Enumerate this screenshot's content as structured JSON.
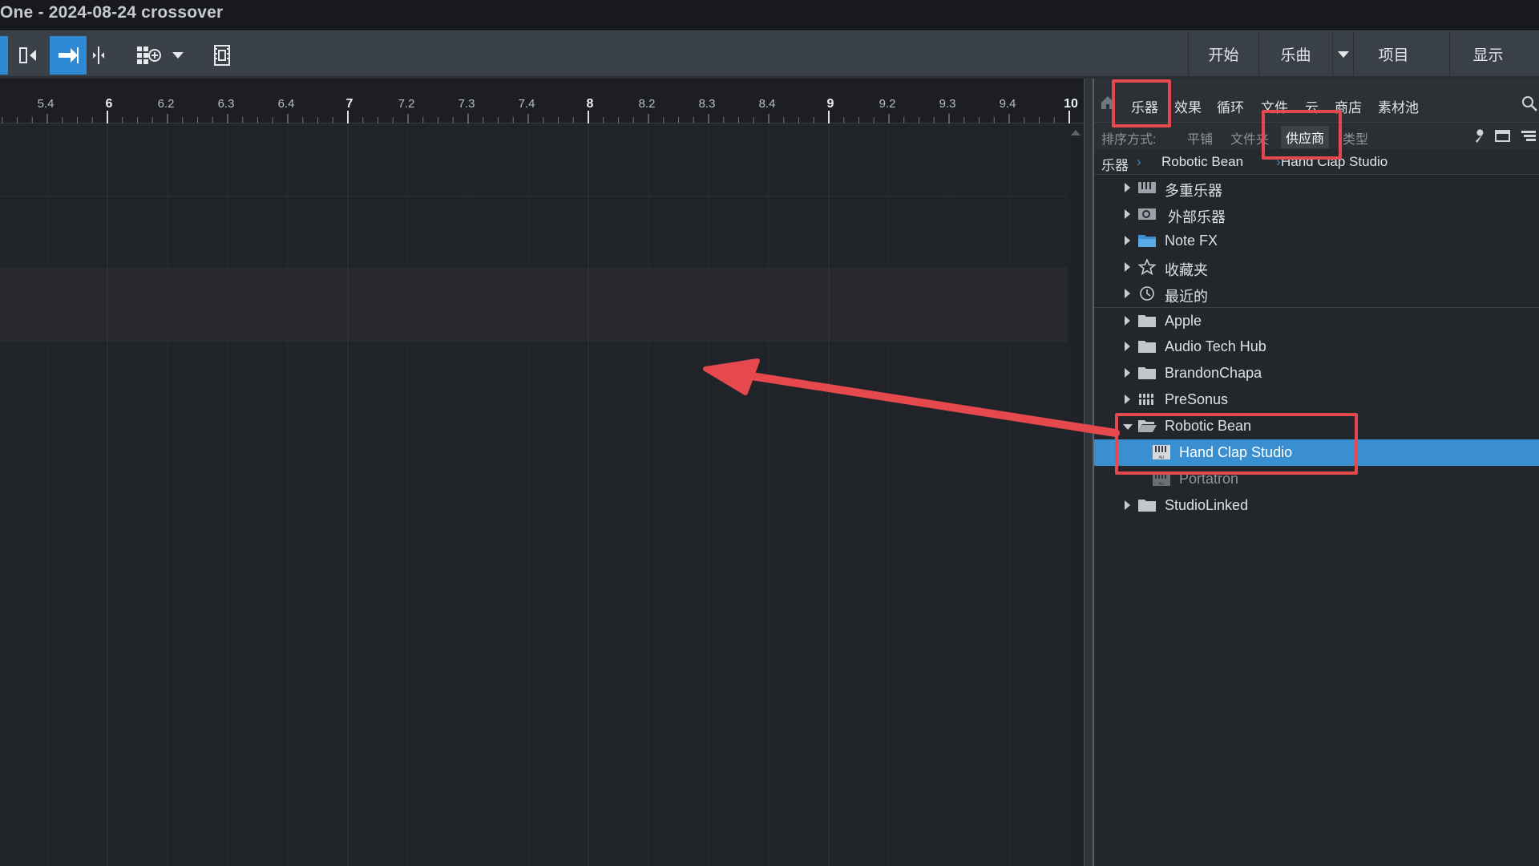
{
  "window": {
    "title": "One - 2024-08-24 crossover"
  },
  "toolbar": {
    "right_buttons": [
      "开始",
      "乐曲",
      "项目",
      "显示"
    ]
  },
  "ruler": {
    "labels": [
      "5.4",
      "6",
      "6.2",
      "6.3",
      "6.4",
      "7",
      "7.2",
      "7.3",
      "7.4",
      "8",
      "8.2",
      "8.3",
      "8.4",
      "9",
      "9.2",
      "9.3",
      "9.4",
      "10"
    ]
  },
  "browser": {
    "tabs": [
      "乐器",
      "效果",
      "循环",
      "文件",
      "云",
      "商店",
      "素材池"
    ],
    "sort_label": "排序方式:",
    "sort_options": [
      "平铺",
      "文件夹",
      "供应商",
      "类型"
    ],
    "breadcrumb": [
      "乐器",
      "Robotic Bean",
      "Hand Clap Studio"
    ],
    "items": [
      {
        "label": "多重乐器",
        "icon": "multi-instrument-icon"
      },
      {
        "label": "外部乐器",
        "icon": "external-instrument-icon"
      },
      {
        "label": "Note FX",
        "icon": "note-fx-folder-icon"
      },
      {
        "label": "收藏夹",
        "icon": "star-icon"
      },
      {
        "label": "最近的",
        "icon": "clock-icon"
      },
      {
        "label": "Apple",
        "icon": "folder-icon"
      },
      {
        "label": "Audio Tech Hub",
        "icon": "folder-icon"
      },
      {
        "label": "BrandonChapa",
        "icon": "folder-icon"
      },
      {
        "label": "PreSonus",
        "icon": "presonus-icon"
      },
      {
        "label": "Robotic Bean",
        "icon": "open-folder-icon"
      },
      {
        "label": "Hand Clap Studio",
        "icon": "au-plugin-icon"
      },
      {
        "label": "Portatron",
        "icon": "au-plugin-icon"
      },
      {
        "label": "StudioLinked",
        "icon": "folder-icon"
      }
    ]
  },
  "colors": {
    "accent": "#3a8fd0",
    "highlight": "#e5484d"
  }
}
